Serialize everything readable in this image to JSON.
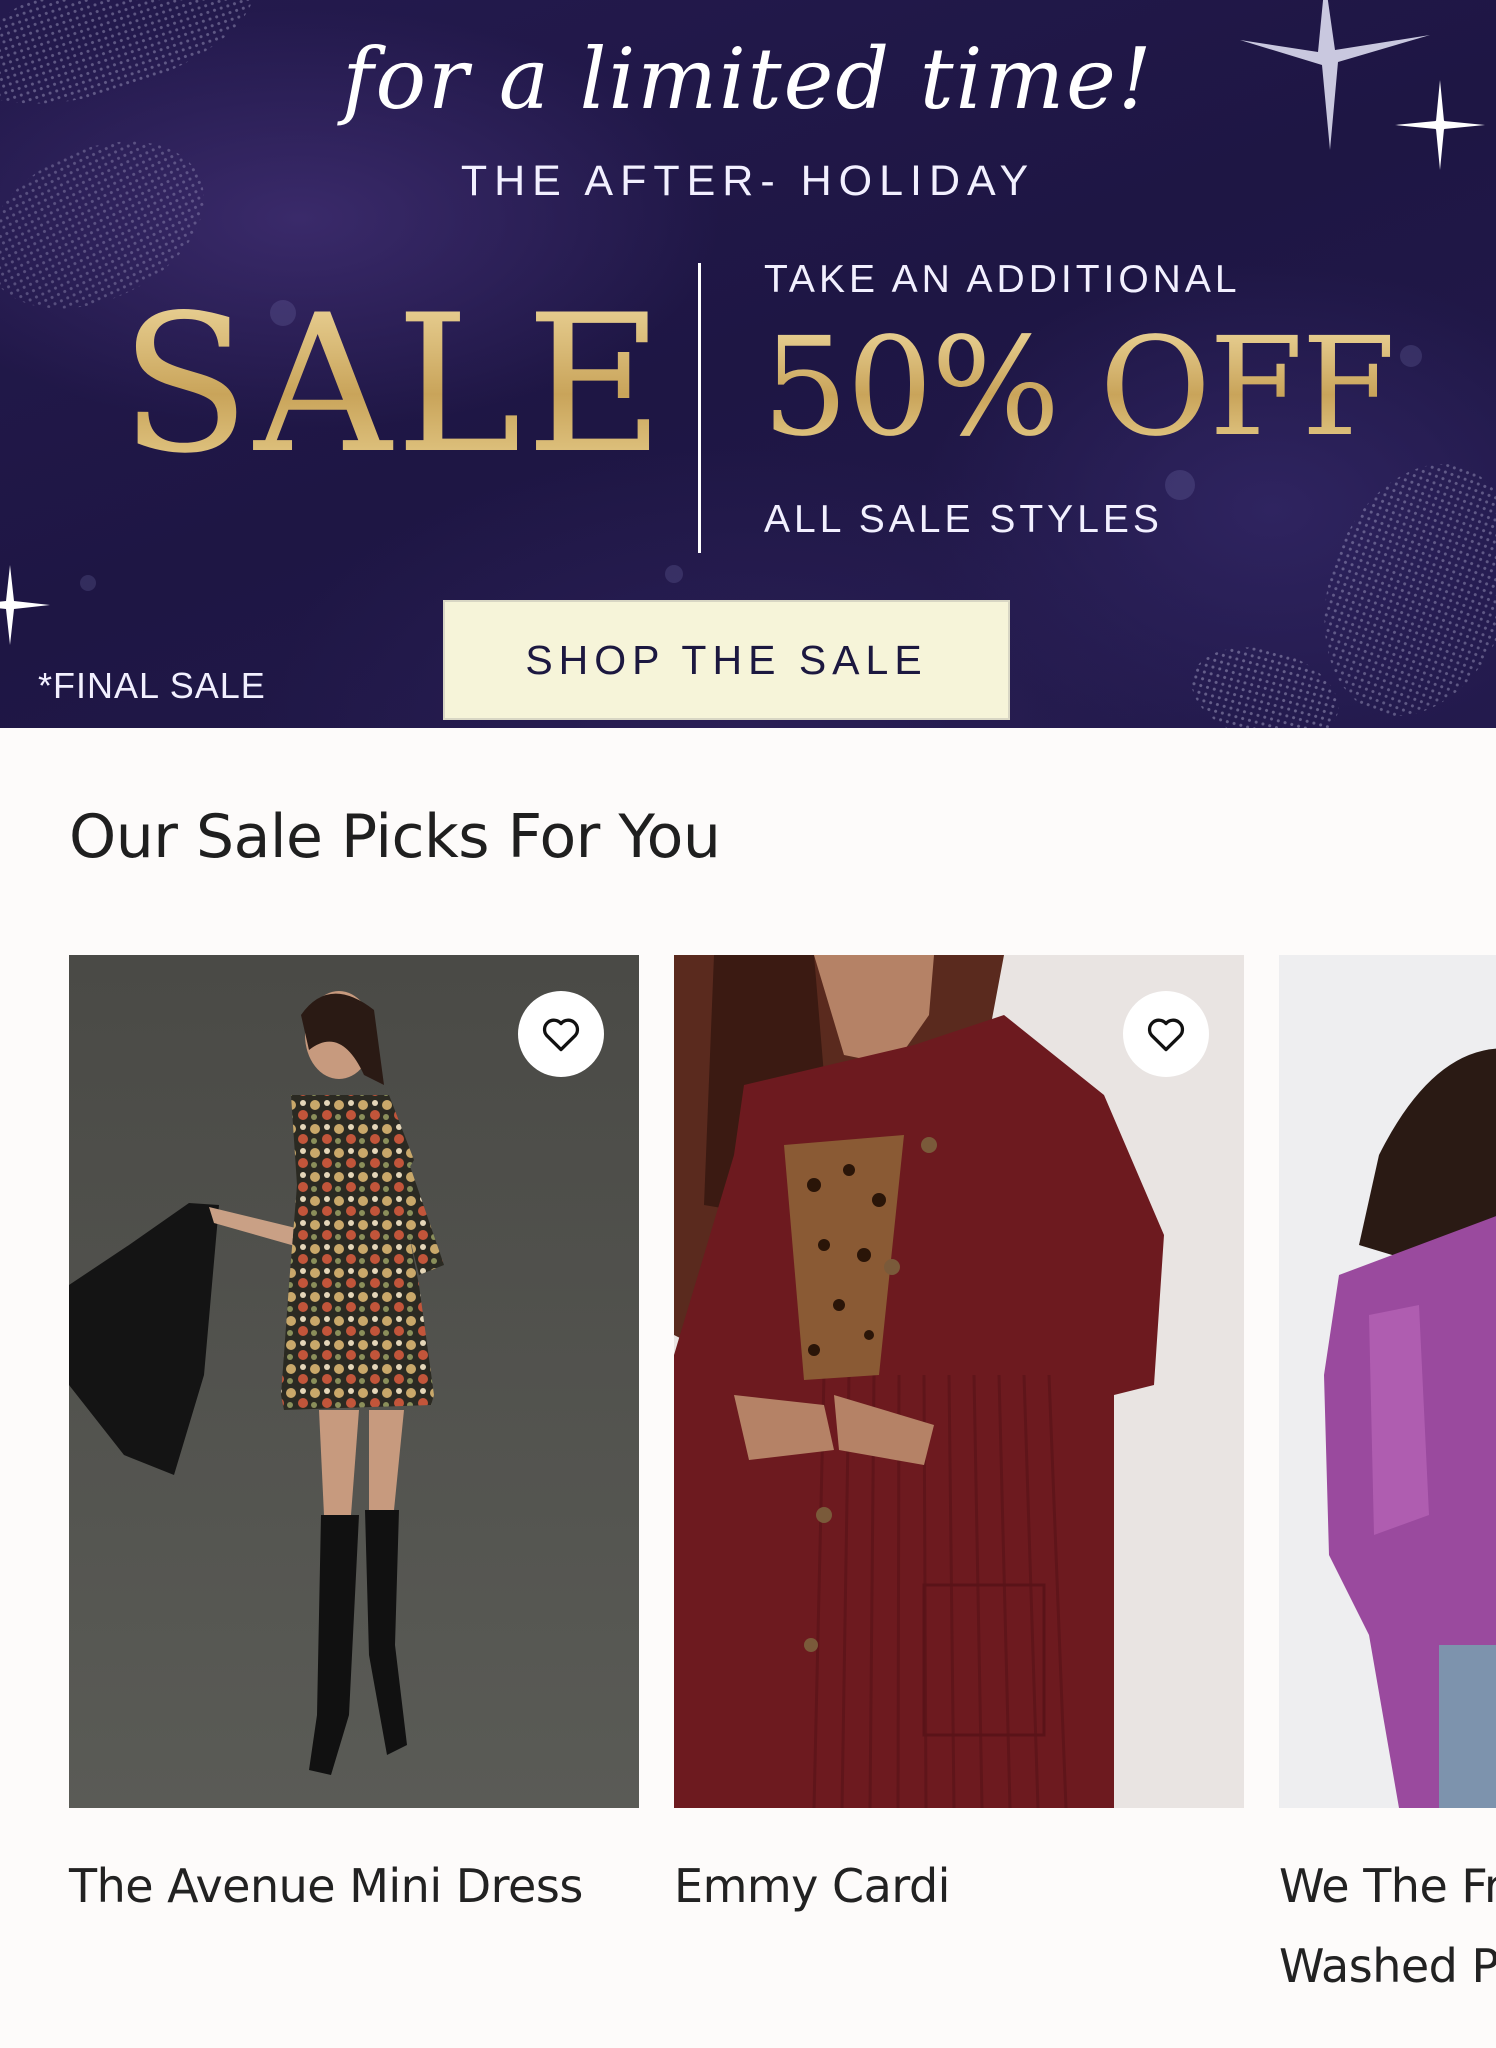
{
  "banner": {
    "script_line": "for a limited time!",
    "subtitle": "THE AFTER- HOLIDAY",
    "sale_word": "SALE",
    "offer_prefix": "TAKE AN ADDITIONAL",
    "offer_value": "50% OFF",
    "offer_suffix": "ALL SALE STYLES",
    "disclaimer": "*FINAL SALE",
    "cta_label": "SHOP THE SALE",
    "colors": {
      "background": "#221a4c",
      "gold": "#d4b46a",
      "cta_bg": "#f6f4d9"
    }
  },
  "picks": {
    "title": "Our Sale Picks For You",
    "products": [
      {
        "name": "The Avenue Mini Dress",
        "favorite_icon": "heart-outline-icon"
      },
      {
        "name": "Emmy Cardi",
        "favorite_icon": "heart-outline-icon"
      },
      {
        "name": "We The Free Favorite Washed Pullover",
        "favorite_icon": "heart-outline-icon"
      }
    ]
  }
}
